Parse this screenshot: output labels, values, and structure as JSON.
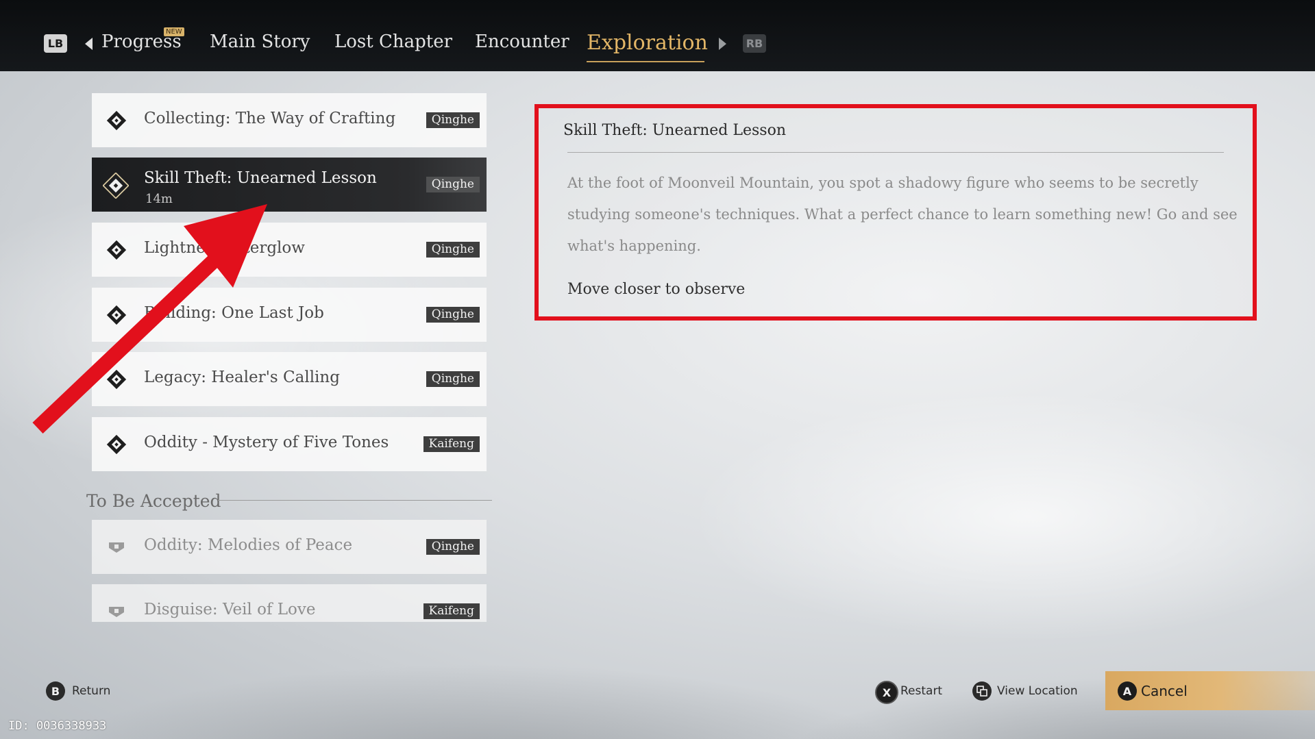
{
  "topbar": {
    "lb": "LB",
    "rb": "RB",
    "new_badge": "NEW",
    "tabs": [
      {
        "label": "Progress"
      },
      {
        "label": "Main Story"
      },
      {
        "label": "Lost Chapter"
      },
      {
        "label": "Encounter"
      },
      {
        "label": "Exploration",
        "active": true
      }
    ]
  },
  "quests": [
    {
      "title": "Collecting: The Way of Crafting",
      "location": "Qinghe"
    },
    {
      "title": "Skill Theft: Unearned Lesson",
      "time": "14m",
      "location": "Qinghe",
      "selected": true
    },
    {
      "title": "Lightness Afterglow",
      "location": "Qinghe"
    },
    {
      "title": "Building: One Last Job",
      "location": "Qinghe"
    },
    {
      "title": "Legacy: Healer's Calling",
      "location": "Qinghe"
    },
    {
      "title": "Oddity - Mystery of Five Tones",
      "location": "Kaifeng"
    }
  ],
  "to_be_accepted": {
    "heading": "To Be Accepted",
    "items": [
      {
        "title": "Oddity: Melodies of Peace",
        "location": "Qinghe"
      },
      {
        "title": "Disguise: Veil of Love",
        "location": "Kaifeng"
      }
    ]
  },
  "detail": {
    "title": "Skill Theft: Unearned Lesson",
    "description": "At the foot of Moonveil Mountain, you spot a shadowy figure who seems to be secretly studying someone's techniques. What a perfect chance to learn something new! Go and see what's happening.",
    "objective": "Move closer to observe"
  },
  "controls": {
    "return": {
      "key": "B",
      "label": "Return"
    },
    "restart": {
      "key": "X",
      "label": "Restart"
    },
    "view_location": {
      "label": "View Location"
    },
    "cancel": {
      "key": "A",
      "label": "Cancel"
    }
  },
  "watermark": "ID: 0036338933",
  "colors": {
    "accent_gold": "#e3b667",
    "highlight_red": "#e2101c"
  }
}
